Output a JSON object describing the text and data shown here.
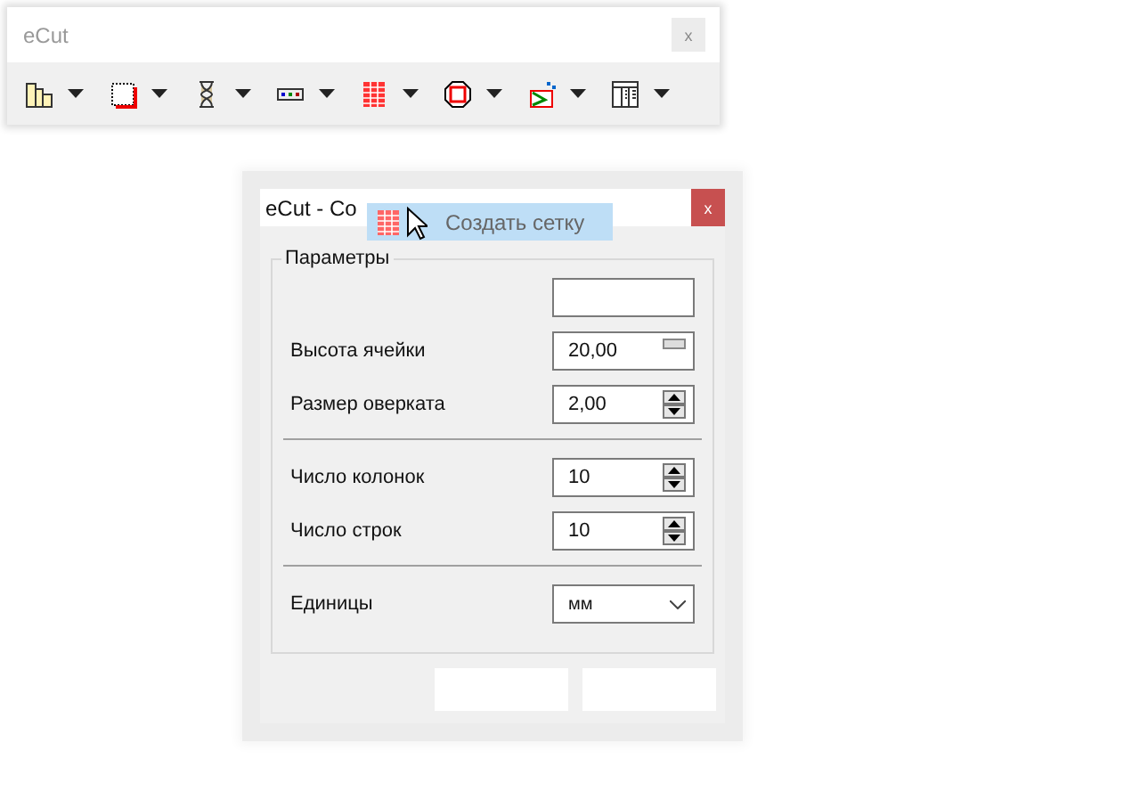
{
  "toolbar_window": {
    "title": "eCut",
    "close": "x"
  },
  "dialog": {
    "title": "eCut - Со",
    "close": "x",
    "drag_label": "Создать сетку",
    "group_title": "Параметры",
    "rows": [
      {
        "kind": "field",
        "label": null,
        "value": null
      },
      {
        "kind": "spin-flat",
        "label": "Высота ячейки",
        "value": "20,00"
      },
      {
        "kind": "spin",
        "label": "Размер оверката",
        "value": "2,00"
      },
      {
        "kind": "separator"
      },
      {
        "kind": "spin",
        "label": "Число колонок",
        "value": "10"
      },
      {
        "kind": "spin",
        "label": "Число строк",
        "value": "10"
      },
      {
        "kind": "separator"
      },
      {
        "kind": "combo",
        "label": "Единицы",
        "value": "мм"
      }
    ]
  }
}
